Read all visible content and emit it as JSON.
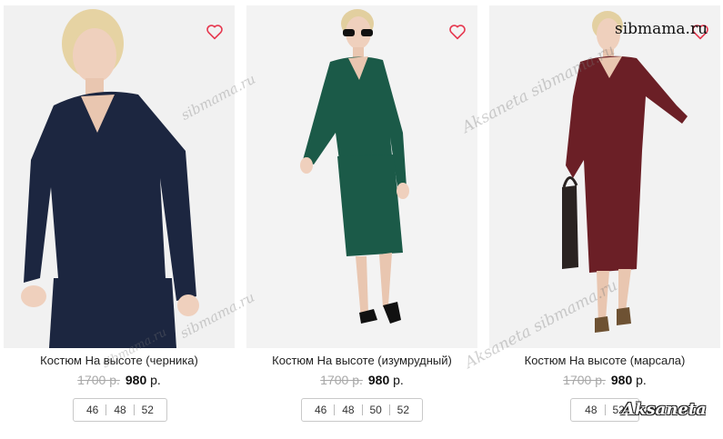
{
  "products": [
    {
      "title": "Костюм На высоте (черника)",
      "old_price": "1700 р.",
      "new_price": "980",
      "currency": "р.",
      "sizes": [
        "46",
        "48",
        "52"
      ],
      "garment_color": "#1c2640",
      "photo_bg": "#f1f1f1"
    },
    {
      "title": "Костюм На высоте (изумрудный)",
      "old_price": "1700 р.",
      "new_price": "980",
      "currency": "р.",
      "sizes": [
        "46",
        "48",
        "50",
        "52"
      ],
      "garment_color": "#1b5a48",
      "photo_bg": "#f3f3f3"
    },
    {
      "title": "Костюм На высоте (марсала)",
      "old_price": "1700 р.",
      "new_price": "980",
      "currency": "р.",
      "sizes": [
        "48",
        "52"
      ],
      "garment_color": "#6b1f26",
      "photo_bg": "#f2f2f2"
    }
  ],
  "favorite_icon": "heart-outline-icon",
  "accent_color": "#e63950",
  "watermarks": {
    "site": "sibmama.ru",
    "site_top": "sibmama.ru",
    "brand_site": "Aksaneta sibmama.ru",
    "signature": "Aksaneta"
  }
}
